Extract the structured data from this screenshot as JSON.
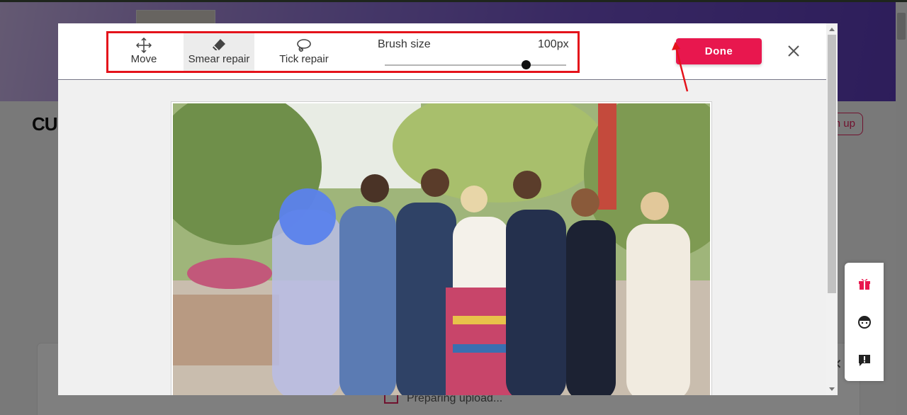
{
  "background": {
    "logo": "CU",
    "signup_label": "n up",
    "upload_status": "Preparing upload..."
  },
  "toolbar": {
    "tools": [
      {
        "label": "Move",
        "icon": "move-icon",
        "active": false
      },
      {
        "label": "Smear repair",
        "icon": "eraser-icon",
        "active": true
      },
      {
        "label": "Tick repair",
        "icon": "lasso-icon",
        "active": false
      }
    ],
    "brush_label": "Brush size",
    "brush_value": "100px",
    "brush_level_percent": 78
  },
  "actions": {
    "done_label": "Done",
    "close_icon": "close-icon"
  },
  "side_widget": {
    "icons": [
      "gift-icon",
      "support-agent-icon",
      "feedback-icon"
    ]
  },
  "colors": {
    "accent": "#e8174e",
    "highlight_box": "#e4131b",
    "brush_cursor": "#5b82ec"
  }
}
